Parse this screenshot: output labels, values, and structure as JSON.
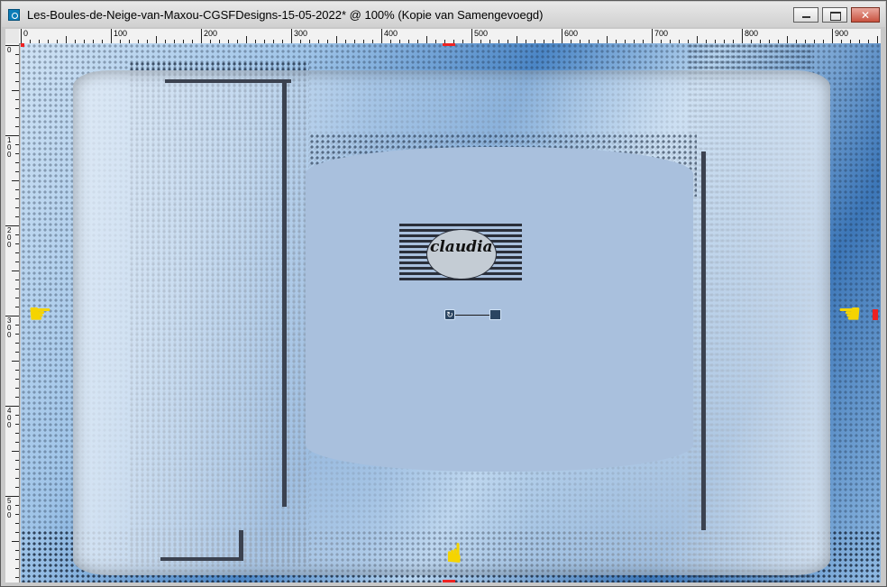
{
  "window": {
    "title": "Les-Boules-de-Neige-van-Maxou-CGSFDesigns-15-05-2022* @ 100% (Kopie van Samengevoegd)",
    "icon": "app-icon",
    "controls": {
      "minimize": "minimize-icon",
      "maximize": "maximize-icon",
      "close": "close-icon"
    }
  },
  "rulers": {
    "horizontal_labels": [
      "0",
      "100",
      "200",
      "300",
      "400",
      "500",
      "600",
      "700",
      "800",
      "900"
    ],
    "vertical_labels": [
      "0",
      "100",
      "200",
      "300",
      "400",
      "500"
    ]
  },
  "canvas": {
    "watermark_text": "claudia",
    "pointer_icons": [
      "hand-pointer-right-icon",
      "hand-pointer-left-icon",
      "hand-pointer-up-icon"
    ],
    "colors": {
      "background_blue": "#6fa6d9",
      "center_panel": "#a9c0dd",
      "pointer": "#f5d400",
      "marker": "#e22222"
    }
  }
}
